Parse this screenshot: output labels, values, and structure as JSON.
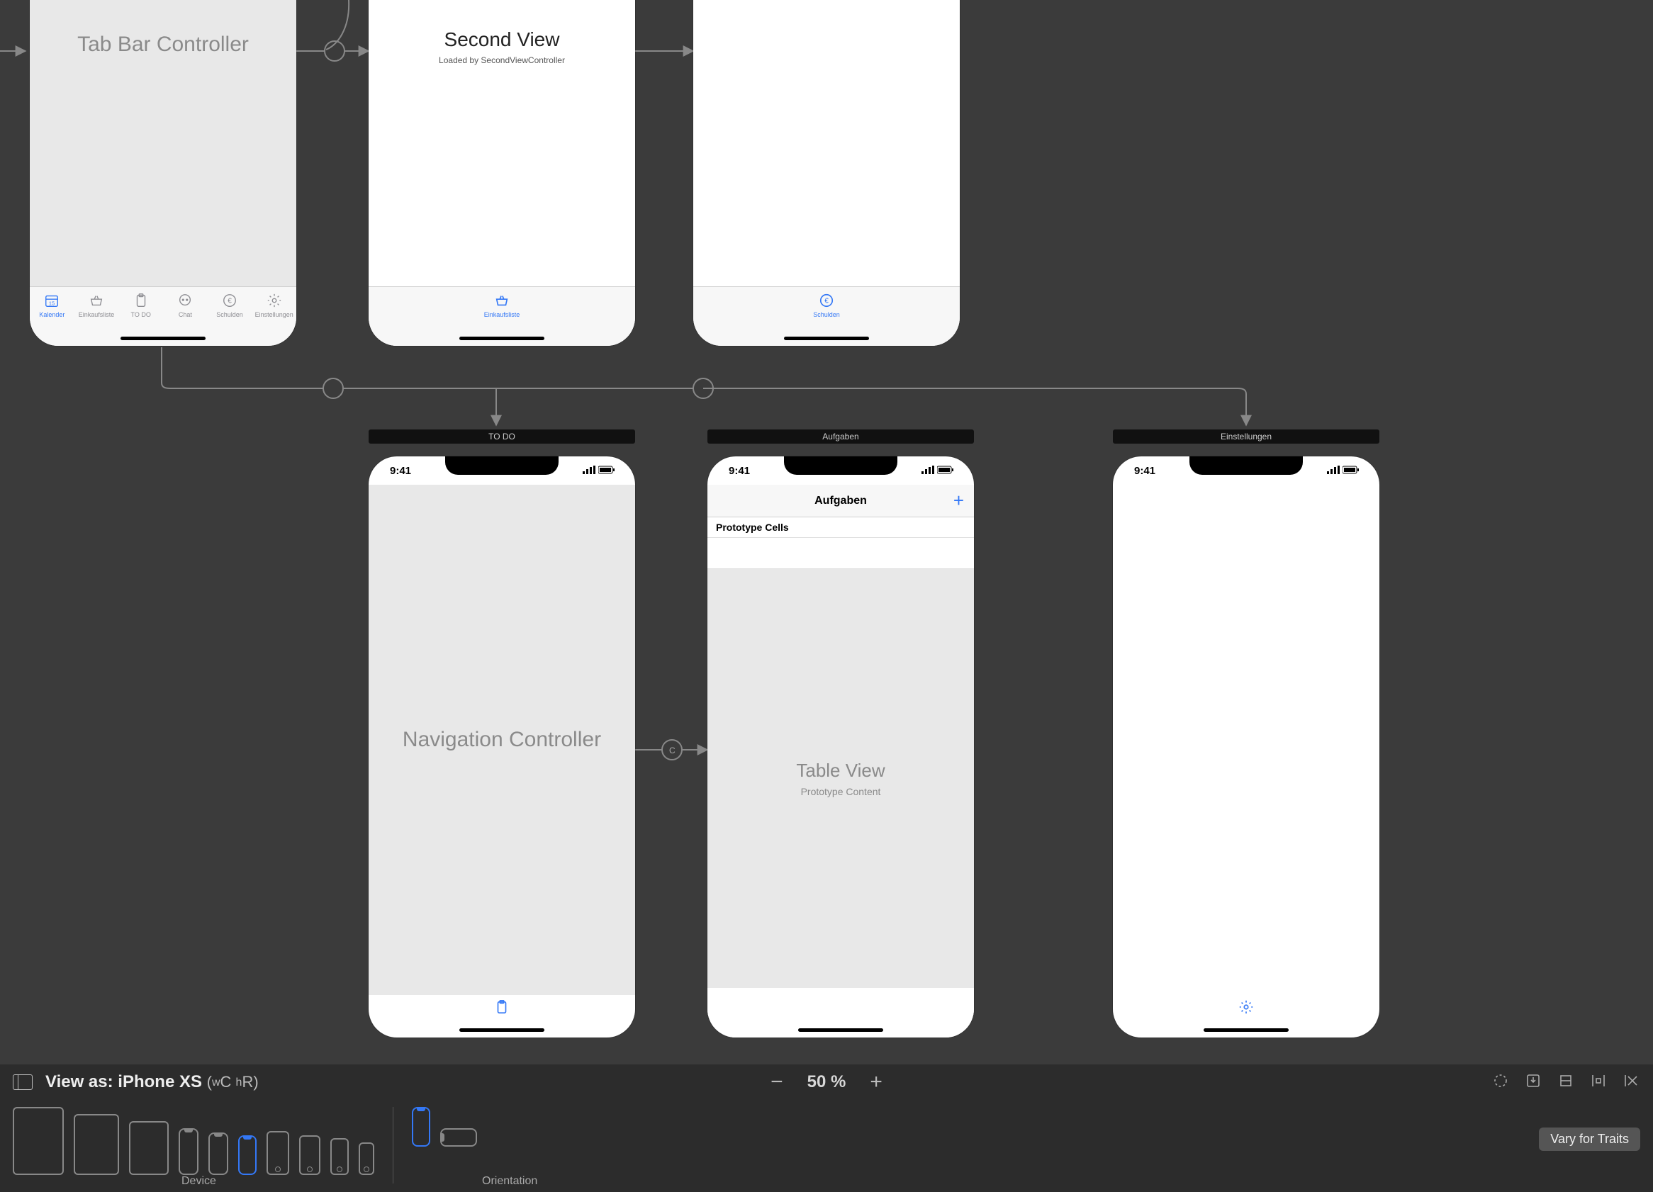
{
  "scenes": {
    "tabbar_controller": {
      "title": "Tab Bar Controller"
    },
    "second_view": {
      "title": "Second View",
      "subtitle": "Loaded by SecondViewController"
    },
    "todo_scene_header": "TO DO",
    "aufgaben_scene_header": "Aufgaben",
    "einstellungen_scene_header": "Einstellungen",
    "nav_controller_title": "Navigation Controller",
    "aufgaben": {
      "navbar_title": "Aufgaben",
      "section_header": "Prototype Cells",
      "tableview_title": "Table View",
      "tableview_sub": "Prototype Content"
    }
  },
  "tabs": {
    "items": [
      {
        "label": "Kalender",
        "icon": "calendar"
      },
      {
        "label": "Einkaufsliste",
        "icon": "basket"
      },
      {
        "label": "TO DO",
        "icon": "clipboard"
      },
      {
        "label": "Chat",
        "icon": "chat"
      },
      {
        "label": "Schulden",
        "icon": "euro"
      },
      {
        "label": "Einstellungen",
        "icon": "gear"
      }
    ],
    "single_basket": "Einkaufsliste",
    "single_schulden": "Schulden"
  },
  "statusbar": {
    "time": "9:41"
  },
  "traitbar": {
    "view_as_prefix": "View as: ",
    "device_name": "iPhone XS",
    "size_class": "(wC hR)",
    "size_class_w": "w",
    "size_class_C": "C ",
    "size_class_h": "h",
    "size_class_R": "R",
    "zoom_label": "50 %",
    "device_group": "Device",
    "orientation_group": "Orientation",
    "vary_label": "Vary for Traits"
  }
}
